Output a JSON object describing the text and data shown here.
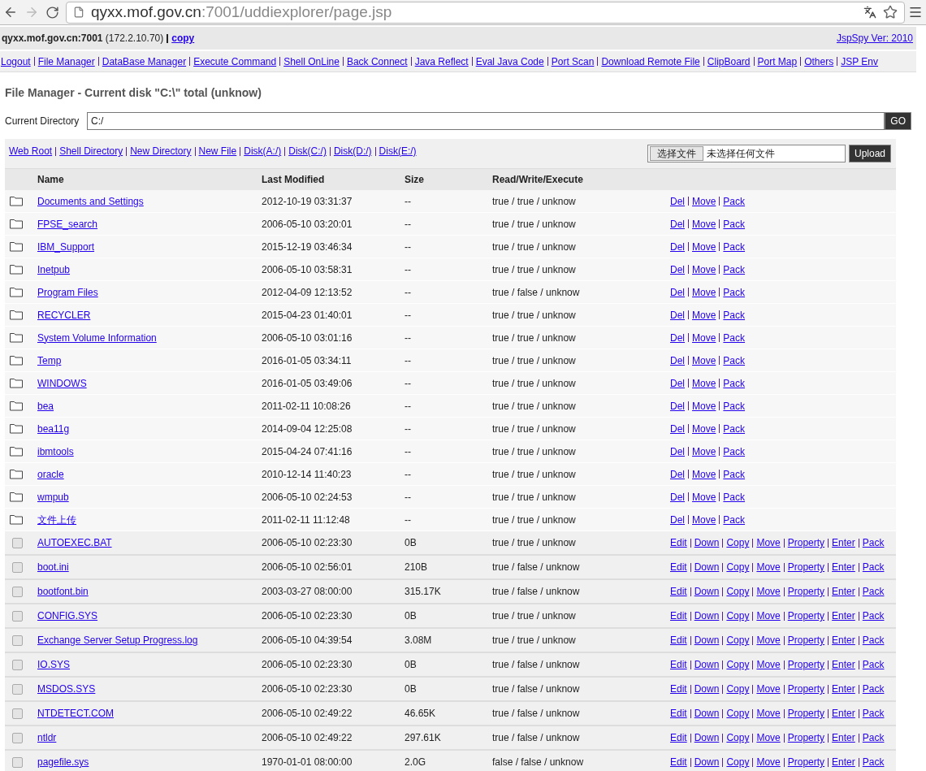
{
  "browser": {
    "url_host": "qyxx.mof.gov.cn",
    "url_rest": ":7001/uddiexplorer/page.jsp",
    "forward_disabled": true
  },
  "info_bar": {
    "host": "**qyxx.mof.gov.cn:7001** (172.2.10.70)",
    "copy_link": "copy",
    "version_link": "JspSpy Ver: 2010"
  },
  "nav": [
    "Logout",
    "File Manager",
    "DataBase Manager",
    "Execute Command",
    "Shell OnLine",
    "Back Connect",
    "Java Reflect",
    "Eval Java Code",
    "Port Scan",
    "Download Remote File",
    "ClipBoard",
    "Port Map",
    "Others",
    "JSP Env"
  ],
  "heading": "File Manager - Current disk \"C:\\\" total (unknow)",
  "directory": {
    "label": "Current Directory",
    "value": "C:/",
    "go": "GO"
  },
  "toolbar": {
    "links": [
      "Web Root",
      "Shell Directory",
      "New Directory",
      "New File",
      "Disk(A:/)",
      "Disk(C:/)",
      "Disk(D:/)",
      "Disk(E:/)"
    ],
    "choose_file": "选择文件",
    "no_file": "未选择任何文件",
    "upload": "Upload"
  },
  "table": {
    "columns": [
      "Name",
      "Last Modified",
      "Size",
      "Read/Write/Execute"
    ],
    "rows": [
      {
        "kind": "folder",
        "name": "Documents and Settings",
        "modified": "2012-10-19 03:31:37",
        "size": "--",
        "rwe": "true / true / unknow",
        "actions": [
          "Del",
          "Move",
          "Pack"
        ]
      },
      {
        "kind": "folder",
        "name": "FPSE_search",
        "modified": "2006-05-10 03:20:01",
        "size": "--",
        "rwe": "true / true / unknow",
        "actions": [
          "Del",
          "Move",
          "Pack"
        ]
      },
      {
        "kind": "folder",
        "name": "IBM_Support",
        "modified": "2015-12-19 03:46:34",
        "size": "--",
        "rwe": "true / true / unknow",
        "actions": [
          "Del",
          "Move",
          "Pack"
        ]
      },
      {
        "kind": "folder",
        "name": "Inetpub",
        "modified": "2006-05-10 03:58:31",
        "size": "--",
        "rwe": "true / true / unknow",
        "actions": [
          "Del",
          "Move",
          "Pack"
        ]
      },
      {
        "kind": "folder",
        "name": "Program Files",
        "modified": "2012-04-09 12:13:52",
        "size": "--",
        "rwe": "true / false / unknow",
        "actions": [
          "Del",
          "Move",
          "Pack"
        ]
      },
      {
        "kind": "folder",
        "name": "RECYCLER",
        "modified": "2015-04-23 01:40:01",
        "size": "--",
        "rwe": "true / true / unknow",
        "actions": [
          "Del",
          "Move",
          "Pack"
        ]
      },
      {
        "kind": "folder",
        "name": "System Volume Information",
        "modified": "2006-05-10 03:01:16",
        "size": "--",
        "rwe": "true / true / unknow",
        "actions": [
          "Del",
          "Move",
          "Pack"
        ]
      },
      {
        "kind": "folder",
        "name": "Temp",
        "modified": "2016-01-05 03:34:11",
        "size": "--",
        "rwe": "true / true / unknow",
        "actions": [
          "Del",
          "Move",
          "Pack"
        ]
      },
      {
        "kind": "folder",
        "name": "WINDOWS",
        "modified": "2016-01-05 03:49:06",
        "size": "--",
        "rwe": "true / true / unknow",
        "actions": [
          "Del",
          "Move",
          "Pack"
        ]
      },
      {
        "kind": "folder",
        "name": "bea",
        "modified": "2011-02-11 10:08:26",
        "size": "--",
        "rwe": "true / true / unknow",
        "actions": [
          "Del",
          "Move",
          "Pack"
        ]
      },
      {
        "kind": "folder",
        "name": "bea11g",
        "modified": "2014-09-04 12:25:08",
        "size": "--",
        "rwe": "true / true / unknow",
        "actions": [
          "Del",
          "Move",
          "Pack"
        ]
      },
      {
        "kind": "folder",
        "name": "ibmtools",
        "modified": "2015-04-24 07:41:16",
        "size": "--",
        "rwe": "true / true / unknow",
        "actions": [
          "Del",
          "Move",
          "Pack"
        ]
      },
      {
        "kind": "folder",
        "name": "oracle",
        "modified": "2010-12-14 11:40:23",
        "size": "--",
        "rwe": "true / true / unknow",
        "actions": [
          "Del",
          "Move",
          "Pack"
        ]
      },
      {
        "kind": "folder",
        "name": "wmpub",
        "modified": "2006-05-10 02:24:53",
        "size": "--",
        "rwe": "true / true / unknow",
        "actions": [
          "Del",
          "Move",
          "Pack"
        ]
      },
      {
        "kind": "folder",
        "name": "文件上传",
        "modified": "2011-02-11 11:12:48",
        "size": "--",
        "rwe": "true / true / unknow",
        "actions": [
          "Del",
          "Move",
          "Pack"
        ]
      },
      {
        "kind": "file",
        "checked": false,
        "name": "AUTOEXEC.BAT",
        "modified": "2006-05-10 02:23:30",
        "size": "0B",
        "rwe": "true / true / unknow",
        "actions": [
          "Edit",
          "Down",
          "Copy",
          "Move",
          "Property",
          "Enter",
          "Pack"
        ]
      },
      {
        "kind": "file",
        "checked": false,
        "name": "boot.ini",
        "modified": "2006-05-10 02:56:01",
        "size": "210B",
        "rwe": "true / false / unknow",
        "actions": [
          "Edit",
          "Down",
          "Copy",
          "Move",
          "Property",
          "Enter",
          "Pack"
        ]
      },
      {
        "kind": "file",
        "checked": false,
        "name": "bootfont.bin",
        "modified": "2003-03-27 08:00:00",
        "size": "315.17K",
        "rwe": "true / false / unknow",
        "actions": [
          "Edit",
          "Down",
          "Copy",
          "Move",
          "Property",
          "Enter",
          "Pack"
        ]
      },
      {
        "kind": "file",
        "checked": false,
        "name": "CONFIG.SYS",
        "modified": "2006-05-10 02:23:30",
        "size": "0B",
        "rwe": "true / true / unknow",
        "actions": [
          "Edit",
          "Down",
          "Copy",
          "Move",
          "Property",
          "Enter",
          "Pack"
        ]
      },
      {
        "kind": "file",
        "checked": false,
        "name": "Exchange Server Setup Progress.log",
        "modified": "2006-05-10 04:39:54",
        "size": "3.08M",
        "rwe": "true / true / unknow",
        "actions": [
          "Edit",
          "Down",
          "Copy",
          "Move",
          "Property",
          "Enter",
          "Pack"
        ]
      },
      {
        "kind": "file",
        "checked": false,
        "name": "IO.SYS",
        "modified": "2006-05-10 02:23:30",
        "size": "0B",
        "rwe": "true / false / unknow",
        "actions": [
          "Edit",
          "Down",
          "Copy",
          "Move",
          "Property",
          "Enter",
          "Pack"
        ]
      },
      {
        "kind": "file",
        "checked": false,
        "name": "MSDOS.SYS",
        "modified": "2006-05-10 02:23:30",
        "size": "0B",
        "rwe": "true / false / unknow",
        "actions": [
          "Edit",
          "Down",
          "Copy",
          "Move",
          "Property",
          "Enter",
          "Pack"
        ]
      },
      {
        "kind": "file",
        "checked": false,
        "name": "NTDETECT.COM",
        "modified": "2006-05-10 02:49:22",
        "size": "46.65K",
        "rwe": "true / false / unknow",
        "actions": [
          "Edit",
          "Down",
          "Copy",
          "Move",
          "Property",
          "Enter",
          "Pack"
        ]
      },
      {
        "kind": "file",
        "checked": false,
        "name": "ntldr",
        "modified": "2006-05-10 02:49:22",
        "size": "297.61K",
        "rwe": "true / false / unknow",
        "actions": [
          "Edit",
          "Down",
          "Copy",
          "Move",
          "Property",
          "Enter",
          "Pack"
        ]
      },
      {
        "kind": "file",
        "checked": false,
        "name": "pagefile.sys",
        "modified": "1970-01-01 08:00:00",
        "size": "2.0G",
        "rwe": "false / false / unknow",
        "actions": [
          "Edit",
          "Down",
          "Copy",
          "Move",
          "Property",
          "Enter",
          "Pack"
        ]
      }
    ]
  }
}
